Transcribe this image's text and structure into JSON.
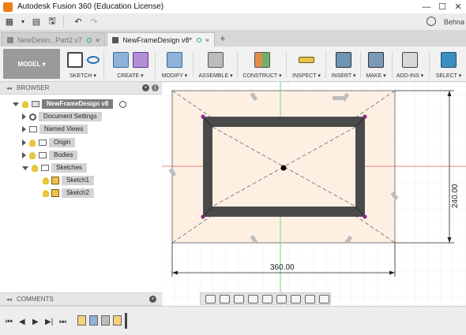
{
  "window": {
    "title": "Autodesk Fusion 360 (Education License)",
    "controls": [
      "minimize-icon",
      "maximize-icon",
      "close-icon"
    ]
  },
  "quick_access": {
    "user": "Behna"
  },
  "tabs": [
    {
      "label": "NewDesin...Part2 v7",
      "active": false
    },
    {
      "label": "NewFrameDesign v8*",
      "active": true
    }
  ],
  "toolbar": {
    "workspace": "MODEL ▾",
    "groups": [
      "SKETCH ▾",
      "CREATE ▾",
      "MODIFY ▾",
      "ASSEMBLE ▾",
      "CONSTRUCT ▾",
      "INSPECT ▾",
      "INSERT ▾",
      "MAKE ▾",
      "ADD-INS ▾",
      "SELECT ▾"
    ]
  },
  "browser": {
    "header": "BROWSER",
    "root": "NewFrameDesign v8",
    "items": [
      "Document Settings",
      "Named Views",
      "Origin",
      "Bodies",
      "Sketches",
      "Sketch1",
      "Sketch2"
    ]
  },
  "comments": {
    "header": "COMMENTS"
  },
  "viewport": {
    "dim_horizontal": "360.00",
    "dim_vertical": "240.00",
    "colors": {
      "sketch_fill": "#fdf0e3",
      "frame": "#4a4a4a",
      "dim_line": "#222222",
      "axis_red": "#e06060",
      "axis_green": "#7bd27b",
      "point": "#8b2a8b"
    }
  }
}
